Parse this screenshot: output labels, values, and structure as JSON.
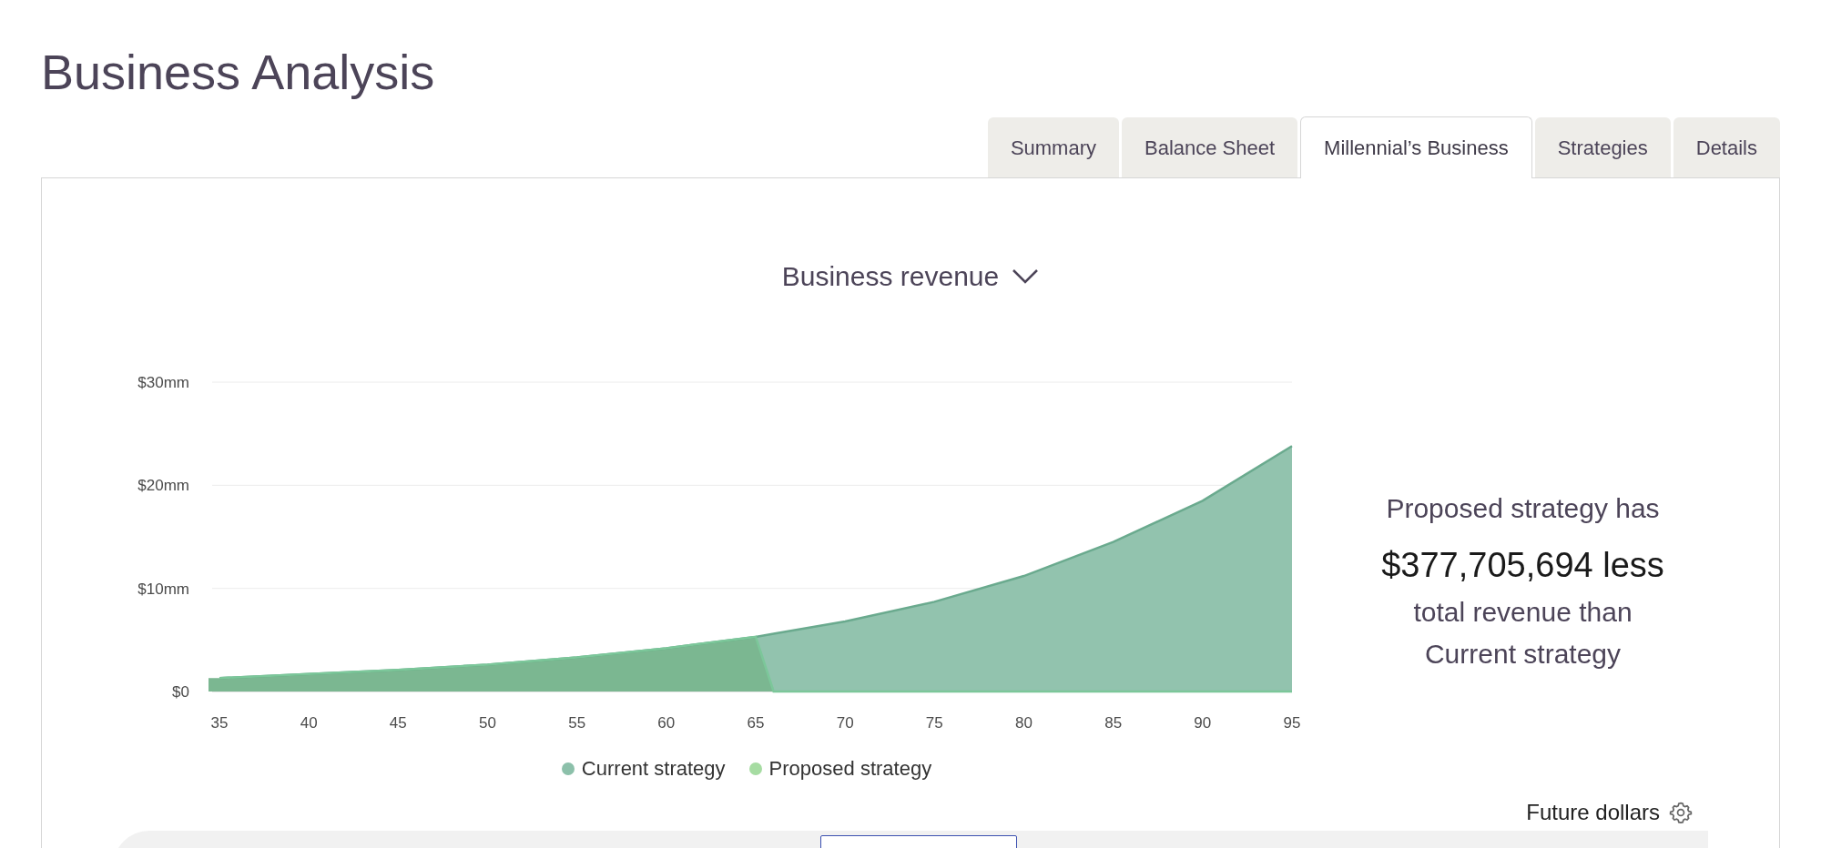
{
  "page_title": "Business Analysis",
  "tabs": [
    {
      "label": "Summary",
      "selected": false
    },
    {
      "label": "Balance Sheet",
      "selected": false
    },
    {
      "label": "Millennial’s Business",
      "selected": true
    },
    {
      "label": "Strategies",
      "selected": false
    },
    {
      "label": "Details",
      "selected": false
    }
  ],
  "chart_selector": {
    "label": "Business revenue"
  },
  "chart_data": {
    "type": "area",
    "x": [
      35,
      40,
      45,
      50,
      55,
      60,
      65,
      66,
      70,
      75,
      80,
      85,
      90,
      95
    ],
    "series": [
      {
        "name": "Current strategy",
        "color": "#8cc0aa",
        "values": [
          1.3,
          1.7,
          2.1,
          2.6,
          3.3,
          4.2,
          5.3,
          5.6,
          6.8,
          8.7,
          11.2,
          14.5,
          18.5,
          23.8
        ]
      },
      {
        "name": "Proposed strategy",
        "color": "#a6dca2",
        "values": [
          1.3,
          1.7,
          2.1,
          2.6,
          3.3,
          4.2,
          5.3,
          0,
          0,
          0,
          0,
          0,
          0,
          0
        ]
      }
    ],
    "ylim": [
      0,
      30
    ],
    "xlim": [
      35,
      95
    ],
    "yticks": [
      {
        "value": 0,
        "label": "$0"
      },
      {
        "value": 10,
        "label": "$10mm"
      },
      {
        "value": 20,
        "label": "$20mm"
      },
      {
        "value": 30,
        "label": "$30mm"
      }
    ],
    "xticks": [
      35,
      40,
      45,
      50,
      55,
      60,
      65,
      70,
      75,
      80,
      85,
      90,
      95
    ]
  },
  "summary": {
    "intro": "Proposed strategy has",
    "amount": "$377,705,694 less",
    "line_2": "total revenue than",
    "line_3": "Current strategy"
  },
  "dollar_mode": {
    "label": "Future dollars"
  }
}
